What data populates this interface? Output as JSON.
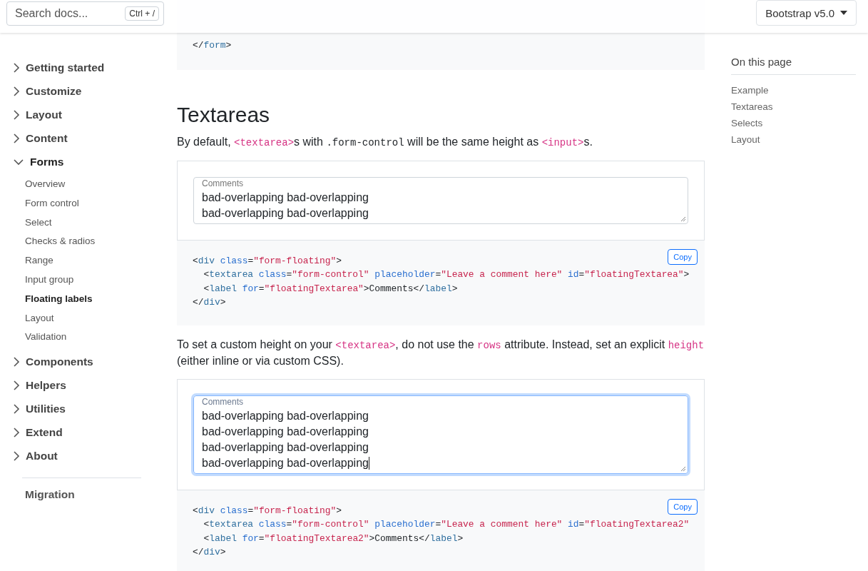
{
  "header": {
    "search": {
      "placeholder": "Search docs...",
      "shortcut": "Ctrl + /"
    },
    "version_button": "Bootstrap v5.0"
  },
  "sidebar": {
    "groups": [
      {
        "label": "Getting started",
        "expanded": false
      },
      {
        "label": "Customize",
        "expanded": false
      },
      {
        "label": "Layout",
        "expanded": false
      },
      {
        "label": "Content",
        "expanded": false
      },
      {
        "label": "Forms",
        "expanded": true,
        "children": [
          {
            "label": "Overview",
            "selected": false
          },
          {
            "label": "Form control",
            "selected": false
          },
          {
            "label": "Select",
            "selected": false
          },
          {
            "label": "Checks & radios",
            "selected": false
          },
          {
            "label": "Range",
            "selected": false
          },
          {
            "label": "Input group",
            "selected": false
          },
          {
            "label": "Floating labels",
            "selected": true
          },
          {
            "label": "Layout",
            "selected": false
          },
          {
            "label": "Validation",
            "selected": false
          }
        ]
      },
      {
        "label": "Components",
        "expanded": false
      },
      {
        "label": "Helpers",
        "expanded": false
      },
      {
        "label": "Utilities",
        "expanded": false
      },
      {
        "label": "Extend",
        "expanded": false
      },
      {
        "label": "About",
        "expanded": false
      }
    ],
    "footer_link": "Migration"
  },
  "content": [
    {
      "kind": "code",
      "lines": [
        [
          {
            "kind": "p",
            "text": "</"
          },
          {
            "kind": "tag",
            "text": "form"
          },
          {
            "kind": "p",
            "text": ">"
          }
        ]
      ]
    },
    {
      "kind": "heading",
      "text": "Textareas"
    },
    {
      "kind": "paragraph",
      "parts": [
        {
          "text": "By default, "
        },
        {
          "text": "<textarea>",
          "code": true
        },
        {
          "text": "s with "
        },
        {
          "text": ".form-control",
          "code": true,
          "plain": true
        },
        {
          "text": " will be the same height as "
        },
        {
          "text": "<input>",
          "code": true
        },
        {
          "text": "s."
        }
      ]
    },
    {
      "kind": "example",
      "label": "Comments",
      "focused": false,
      "lines": [
        "bad-overlapping bad-overlapping",
        "bad-overlapping bad-overlapping"
      ]
    },
    {
      "kind": "code",
      "copy": "Copy",
      "lines": [
        [
          {
            "kind": "p",
            "text": "<"
          },
          {
            "kind": "tag",
            "text": "div"
          },
          {
            "kind": "attr",
            "text": " class"
          },
          {
            "kind": "p",
            "text": "="
          },
          {
            "kind": "str",
            "text": "\"form-floating\""
          },
          {
            "kind": "p",
            "text": ">"
          }
        ],
        [
          {
            "kind": "p",
            "text": "  <"
          },
          {
            "kind": "tag",
            "text": "textarea"
          },
          {
            "kind": "attr",
            "text": " class"
          },
          {
            "kind": "p",
            "text": "="
          },
          {
            "kind": "str",
            "text": "\"form-control\""
          },
          {
            "kind": "attr",
            "text": " placeholder"
          },
          {
            "kind": "p",
            "text": "="
          },
          {
            "kind": "str",
            "text": "\"Leave a comment here\""
          },
          {
            "kind": "attr",
            "text": " id"
          },
          {
            "kind": "p",
            "text": "="
          },
          {
            "kind": "str",
            "text": "\"floatingTextarea\""
          },
          {
            "kind": "p",
            "text": ">"
          }
        ],
        [
          {
            "kind": "p",
            "text": "  <"
          },
          {
            "kind": "tag",
            "text": "label"
          },
          {
            "kind": "attr",
            "text": " for"
          },
          {
            "kind": "p",
            "text": "="
          },
          {
            "kind": "str",
            "text": "\"floatingTextarea\""
          },
          {
            "kind": "p",
            "text": ">Comments</"
          },
          {
            "kind": "tag",
            "text": "label"
          },
          {
            "kind": "p",
            "text": ">"
          }
        ],
        [
          {
            "kind": "p",
            "text": "</"
          },
          {
            "kind": "tag",
            "text": "div"
          },
          {
            "kind": "p",
            "text": ">"
          }
        ]
      ]
    },
    {
      "kind": "paragraph",
      "parts": [
        {
          "text": "To set a custom height on your "
        },
        {
          "text": "<textarea>",
          "code": true
        },
        {
          "text": ", do not use the "
        },
        {
          "text": "rows",
          "code": true
        },
        {
          "text": " attribute. Instead, set an explicit "
        },
        {
          "text": "height",
          "code": true
        },
        {
          "text": " (either inline or via custom CSS)."
        }
      ]
    },
    {
      "kind": "example",
      "label": "Comments",
      "focused": true,
      "lines": [
        "bad-overlapping bad-overlapping",
        "bad-overlapping bad-overlapping",
        "bad-overlapping bad-overlapping",
        "bad-overlapping bad-overlapping"
      ]
    },
    {
      "kind": "code",
      "copy": "Copy",
      "lines": [
        [
          {
            "kind": "p",
            "text": "<"
          },
          {
            "kind": "tag",
            "text": "div"
          },
          {
            "kind": "attr",
            "text": " class"
          },
          {
            "kind": "p",
            "text": "="
          },
          {
            "kind": "str",
            "text": "\"form-floating\""
          },
          {
            "kind": "p",
            "text": ">"
          }
        ],
        [
          {
            "kind": "p",
            "text": "  <"
          },
          {
            "kind": "tag",
            "text": "textarea"
          },
          {
            "kind": "attr",
            "text": " class"
          },
          {
            "kind": "p",
            "text": "="
          },
          {
            "kind": "str",
            "text": "\"form-control\""
          },
          {
            "kind": "attr",
            "text": " placeholder"
          },
          {
            "kind": "p",
            "text": "="
          },
          {
            "kind": "str",
            "text": "\"Leave a comment here\""
          },
          {
            "kind": "attr",
            "text": " id"
          },
          {
            "kind": "p",
            "text": "="
          },
          {
            "kind": "str",
            "text": "\"floatingTextarea2\""
          }
        ],
        [
          {
            "kind": "p",
            "text": "  <"
          },
          {
            "kind": "tag",
            "text": "label"
          },
          {
            "kind": "attr",
            "text": " for"
          },
          {
            "kind": "p",
            "text": "="
          },
          {
            "kind": "str",
            "text": "\"floatingTextarea2\""
          },
          {
            "kind": "p",
            "text": ">Comments</"
          },
          {
            "kind": "tag",
            "text": "label"
          },
          {
            "kind": "p",
            "text": ">"
          }
        ],
        [
          {
            "kind": "p",
            "text": "</"
          },
          {
            "kind": "tag",
            "text": "div"
          },
          {
            "kind": "p",
            "text": ">"
          }
        ]
      ]
    }
  ],
  "toc": {
    "title": "On this page",
    "items": [
      "Example",
      "Textareas",
      "Selects",
      "Layout"
    ]
  }
}
